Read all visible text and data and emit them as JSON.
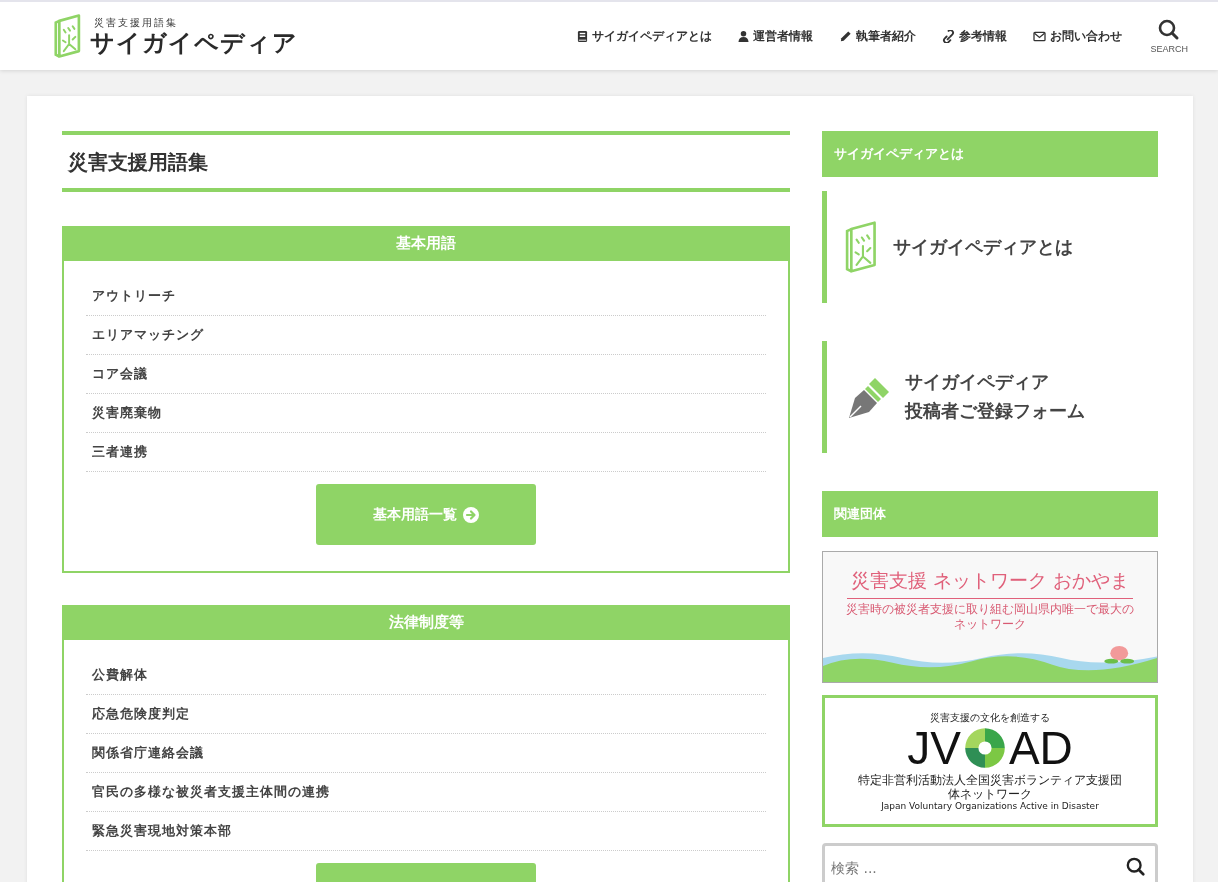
{
  "header": {
    "logo": {
      "subtitle": "災害支援用語集",
      "title": "サイガイペディア"
    },
    "nav": [
      {
        "label": "サイガイペディアとは"
      },
      {
        "label": "運営者情報"
      },
      {
        "label": "執筆者紹介"
      },
      {
        "label": "参考情報"
      },
      {
        "label": "お問い合わせ"
      }
    ],
    "search_label": "SEARCH"
  },
  "page_title": "災害支援用語集",
  "sections": [
    {
      "heading": "基本用語",
      "items": [
        "アウトリーチ",
        "エリアマッチング",
        "コア会議",
        "災害廃棄物",
        "三者連携"
      ],
      "button_label": "基本用語一覧"
    },
    {
      "heading": "法律制度等",
      "items": [
        "公費解体",
        "応急危険度判定",
        "関係省庁連絡会議",
        "官民の多様な被災者支援主体間の連携",
        "緊急災害現地対策本部"
      ]
    }
  ],
  "sidebar": [
    {
      "kind": "heading",
      "text": "サイガイペディアとは"
    },
    {
      "kind": "intro-banner",
      "lines": [
        "サイガイペディアとは"
      ]
    },
    {
      "kind": "form-banner",
      "lines": [
        "サイガイペディア",
        "投稿者ご登録フォーム"
      ]
    },
    {
      "kind": "heading",
      "text": "関連団体"
    },
    {
      "kind": "okayama-banner",
      "title": "災害支援 ネットワーク おかやま",
      "tagline": "災害時の被災者支援に取り組む岡山県内唯一で最大のネットワーク"
    },
    {
      "kind": "jvoad-banner",
      "tagline": "災害支援の文化を創造する",
      "left": "JV",
      "right": "AD",
      "org": "特定非営利活動法人全国災害ボランティア支援団体ネットワーク",
      "english": "Japan Voluntary Organizations Active in Disaster"
    },
    {
      "kind": "search",
      "placeholder": "検索 ..."
    }
  ]
}
